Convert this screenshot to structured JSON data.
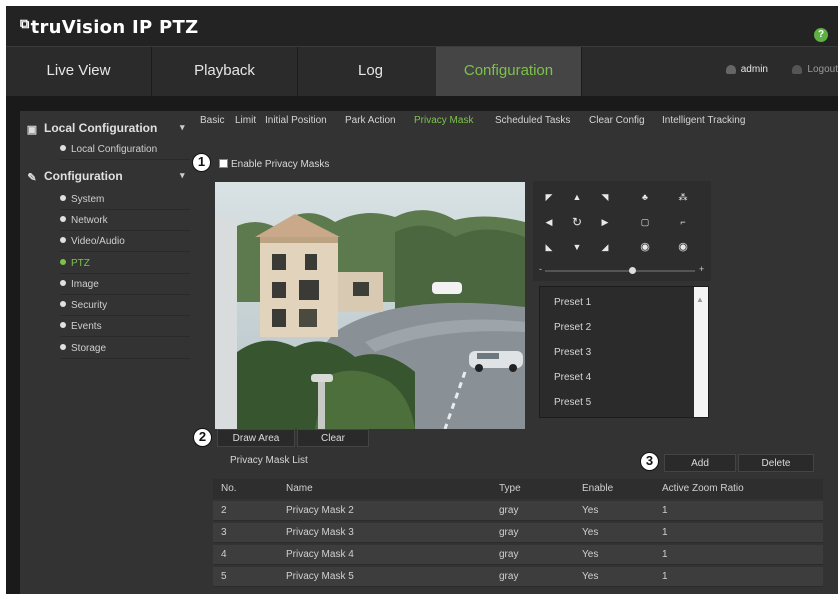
{
  "header": {
    "logo_mark": "⧉",
    "app_title": "truVision IP PTZ",
    "help": "?"
  },
  "nav": {
    "tabs": [
      "Live View",
      "Playback",
      "Log",
      "Configuration"
    ],
    "active_tab": "Configuration",
    "user": "admin",
    "logout": "Logout"
  },
  "sidebar": {
    "local_header": "Local Configuration",
    "local_items": [
      "Local Configuration"
    ],
    "config_header": "Configuration",
    "config_items": [
      "System",
      "Network",
      "Video/Audio",
      "PTZ",
      "Image",
      "Security",
      "Events",
      "Storage"
    ],
    "active_item": "PTZ"
  },
  "subtabs": [
    "Basic",
    "Limit",
    "Initial Position",
    "Park Action",
    "Privacy Mask",
    "Scheduled Tasks",
    "Clear Config",
    "Intelligent Tracking"
  ],
  "active_subtab": "Privacy Mask",
  "callouts": [
    "1",
    "2",
    "3"
  ],
  "privacy": {
    "enable_label": "Enable Privacy Masks",
    "enabled": false
  },
  "ptz": {
    "slider_min": "-",
    "slider_max": "+",
    "presets": [
      "Preset 1",
      "Preset 2",
      "Preset 3",
      "Preset 4",
      "Preset 5"
    ]
  },
  "buttons": {
    "draw_area": "Draw Area",
    "clear": "Clear",
    "add": "Add",
    "delete": "Delete"
  },
  "mask_list": {
    "title": "Privacy Mask List",
    "columns": [
      "No.",
      "Name",
      "Type",
      "Enable",
      "Active Zoom Ratio"
    ],
    "rows": [
      [
        "2",
        "Privacy Mask 2",
        "gray",
        "Yes",
        "1"
      ],
      [
        "3",
        "Privacy Mask 3",
        "gray",
        "Yes",
        "1"
      ],
      [
        "4",
        "Privacy Mask 4",
        "gray",
        "Yes",
        "1"
      ],
      [
        "5",
        "Privacy Mask 5",
        "gray",
        "Yes",
        "1"
      ]
    ]
  },
  "colors": {
    "accent": "#7dc24b",
    "panel": "#333333",
    "header": "#232323"
  }
}
